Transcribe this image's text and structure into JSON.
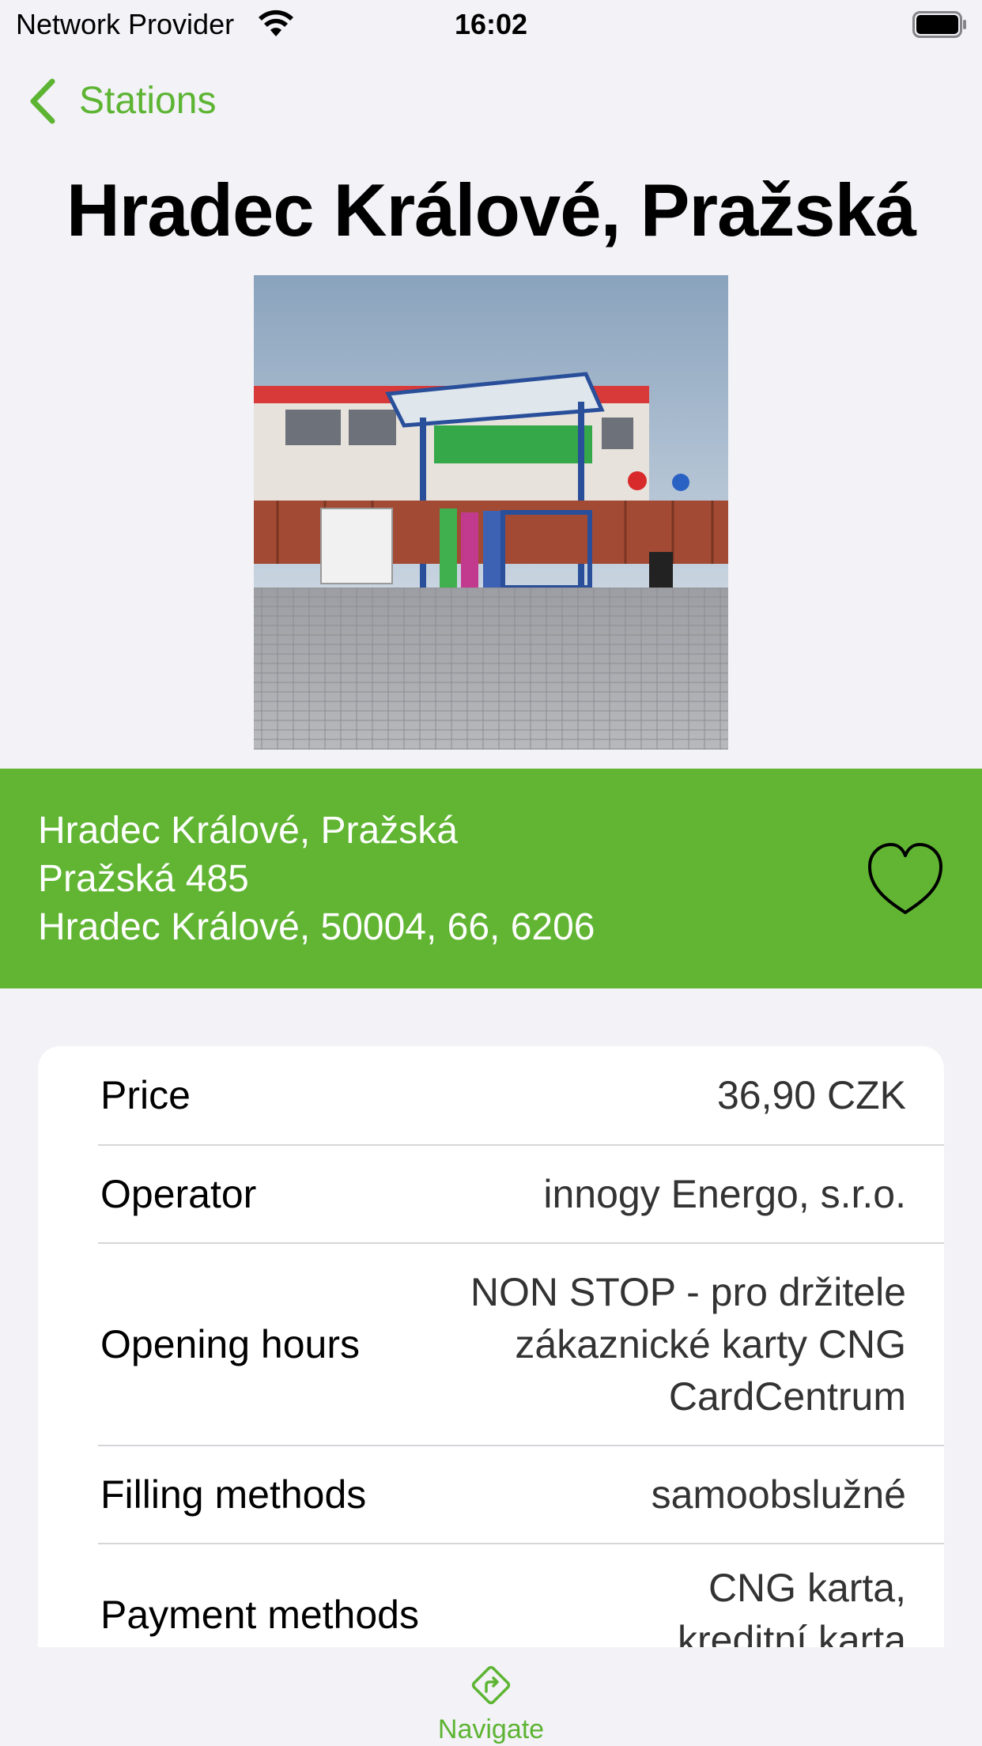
{
  "status_bar": {
    "carrier": "Network Provider",
    "time": "16:02"
  },
  "nav": {
    "back_label": "Stations"
  },
  "station": {
    "title": "Hradec Králové, Pražská",
    "photo_icon": "station-photo",
    "address_lines": [
      "Hradec Králové, Pražská",
      "Pražská 485",
      "Hradec Králové, 50004, 66, 6206"
    ],
    "favorite_icon": "heart-icon"
  },
  "details": [
    {
      "label": "Price",
      "value": "36,90 CZK"
    },
    {
      "label": "Operator",
      "value": "innogy Energo, s.r.o."
    },
    {
      "label": "Opening hours",
      "value_lines": [
        "NON STOP - pro držitele",
        "zákaznické karty CNG",
        "CardCentrum"
      ]
    },
    {
      "label": "Filling methods",
      "value": "samoobslužné"
    },
    {
      "label": "Payment methods",
      "value_lines": [
        "CNG karta,",
        "kreditní karta"
      ]
    }
  ],
  "tabbar": {
    "navigate_label": "Navigate",
    "navigate_icon": "directions-icon"
  },
  "colors": {
    "accent": "#5db432",
    "banner": "#61b533",
    "background": "#f2f2f7"
  }
}
